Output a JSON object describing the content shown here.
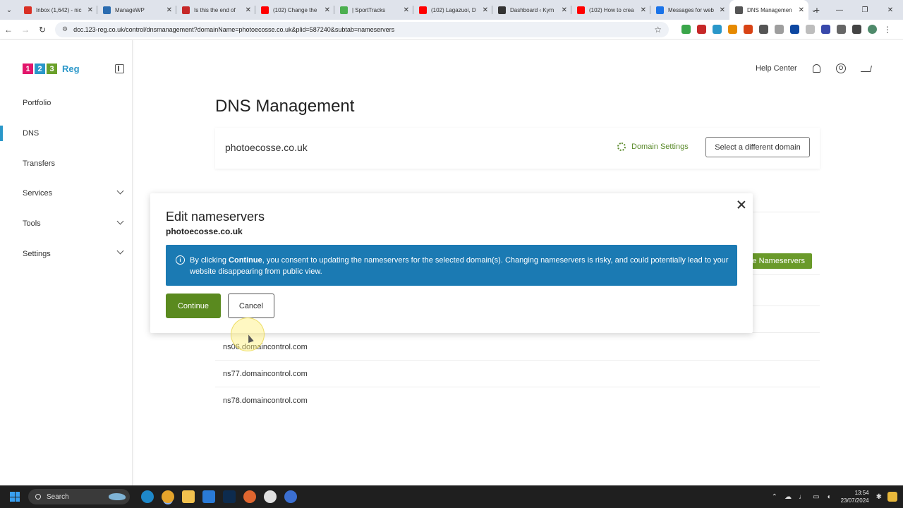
{
  "browser": {
    "tabs": [
      {
        "label": "Inbox (1,642) - nic",
        "color": "#d93025"
      },
      {
        "label": "ManageWP",
        "color": "#2b6cb0"
      },
      {
        "label": "Is this the end of",
        "color": "#c62828"
      },
      {
        "label": "(102) Change the",
        "color": "#ff0000"
      },
      {
        "label": "| SportTracks",
        "color": "#4caf50"
      },
      {
        "label": "(102) Lagazuoi, D",
        "color": "#ff0000"
      },
      {
        "label": "Dashboard ‹ Kym",
        "color": "#333333"
      },
      {
        "label": "(102) How to crea",
        "color": "#ff0000"
      },
      {
        "label": "Messages for web",
        "color": "#1a73e8"
      },
      {
        "label": "DNS Managemen",
        "color": "#555555"
      }
    ],
    "new_tab": "+",
    "url": "dcc.123-reg.co.uk/control/dnsmanagement?domainName=photoecosse.co.uk&plid=587240&subtab=nameservers"
  },
  "brand": {
    "logo_digits": [
      "1",
      "2",
      "3"
    ],
    "logo_colors": [
      "#e2156b",
      "#2a97c9",
      "#6aa02a"
    ],
    "logo_text": "Reg"
  },
  "sidebar": {
    "items": [
      {
        "label": "Portfolio",
        "active": false,
        "expandable": false
      },
      {
        "label": "DNS",
        "active": true,
        "expandable": false
      },
      {
        "label": "Transfers",
        "active": false,
        "expandable": false
      },
      {
        "label": "Services",
        "active": false,
        "expandable": true
      },
      {
        "label": "Tools",
        "active": false,
        "expandable": true
      },
      {
        "label": "Settings",
        "active": false,
        "expandable": true
      }
    ]
  },
  "header": {
    "help": "Help Center"
  },
  "page": {
    "title": "DNS Management",
    "domain": "photoecosse.co.uk",
    "domain_settings": "Domain Settings",
    "select_domain": "Select a different domain",
    "nameservers_button_partial": "e Nameservers",
    "nameservers": [
      "ns06.domaincontrol.com",
      "ns77.domaincontrol.com",
      "ns78.domaincontrol.com"
    ]
  },
  "modal": {
    "title": "Edit nameservers",
    "subtitle": "photoecosse.co.uk",
    "alert_prefix": "By clicking ",
    "alert_bold": "Continue",
    "alert_suffix": ", you consent to updating the nameservers for the selected domain(s). Changing nameservers is risky, and could potentially lead to your website disappearing from public view.",
    "continue_label": "Continue",
    "cancel_label": "Cancel"
  },
  "taskbar": {
    "search_placeholder": "Search",
    "time": "13:54",
    "date": "23/07/2024"
  }
}
